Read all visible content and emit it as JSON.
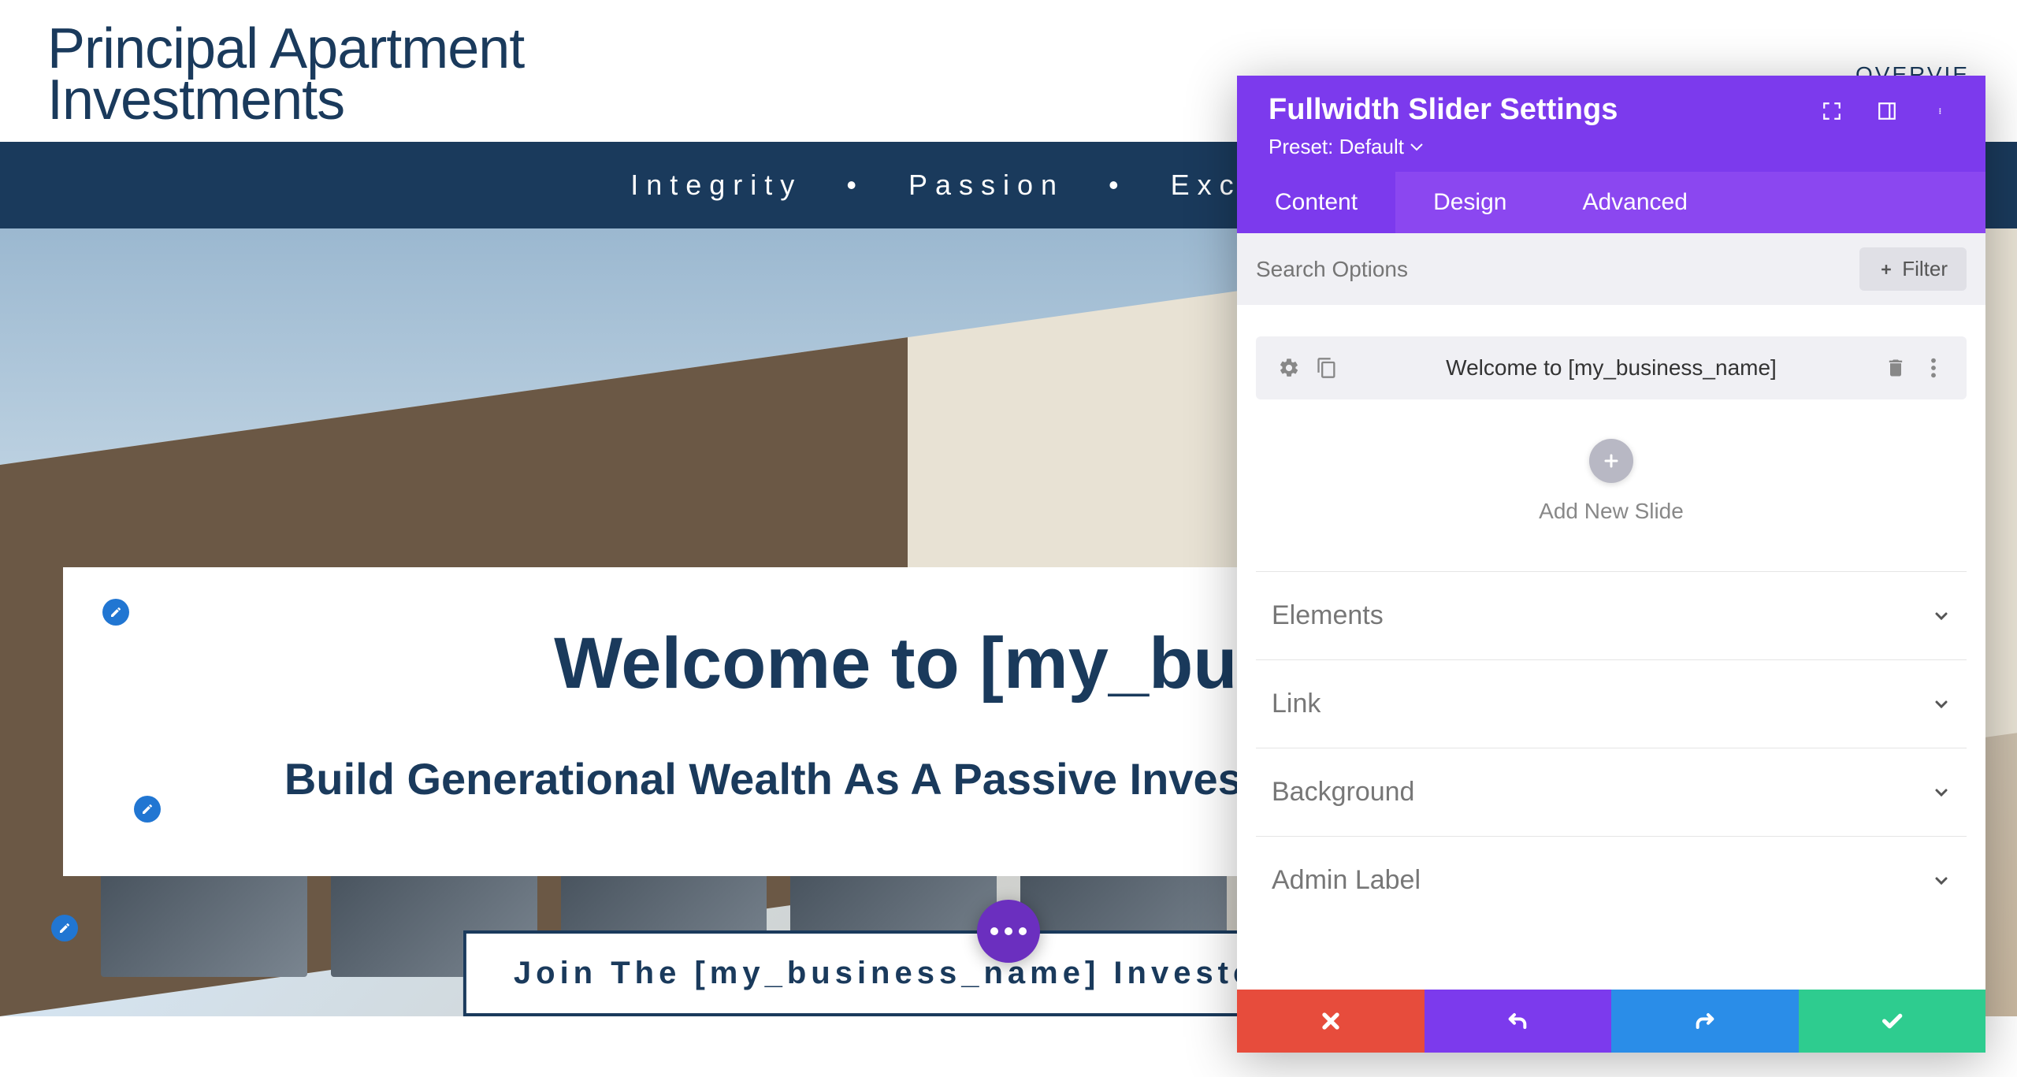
{
  "site": {
    "logo_line1": "Principal Apartment",
    "logo_line2": "Investments",
    "nav_overview": "OVERVIE"
  },
  "tagline": {
    "word1": "Integrity",
    "word2": "Passion",
    "word3": "Excellence"
  },
  "hero": {
    "title": "Welcome to [my_business",
    "subtitle": "Build Generational Wealth As A Passive Investor I Estate Syndication",
    "cta": "Join The [my_business_name] Investor Community"
  },
  "panel": {
    "title": "Fullwidth Slider Settings",
    "preset": "Preset: Default",
    "tabs": {
      "content": "Content",
      "design": "Design",
      "advanced": "Advanced"
    },
    "search_placeholder": "Search Options",
    "filter_label": "Filter",
    "slide_item_label": "Welcome to [my_business_name]",
    "add_new_slide": "Add New Slide",
    "groups": {
      "elements": "Elements",
      "link": "Link",
      "background": "Background",
      "admin_label": "Admin Label"
    }
  }
}
